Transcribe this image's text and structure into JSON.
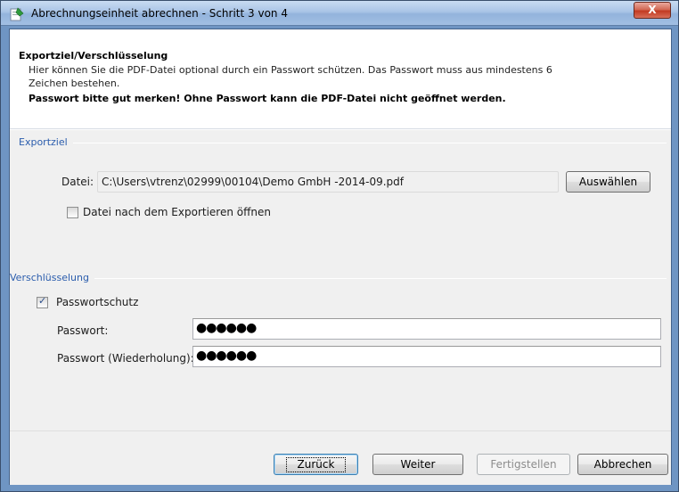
{
  "window": {
    "title": "Abrechnungseinheit abrechnen - Schritt 3 von 4",
    "close_label": "X"
  },
  "header": {
    "title": "Exportziel/Verschlüsselung",
    "description": "Hier können Sie die PDF-Datei optional durch ein Passwort schützen. Das Passwort muss aus mindestens 6 Zeichen bestehen.",
    "warning": "Passwort bitte gut merken! Ohne Passwort kann die PDF-Datei nicht geöffnet werden."
  },
  "exportziel": {
    "group_label": "Exportziel",
    "file_label": "Datei:",
    "file_path": "C:\\Users\\vtrenz\\02999\\00104\\Demo GmbH -2014-09.pdf",
    "choose_button": "Auswählen",
    "open_after_export_label": "Datei nach dem Exportieren öffnen",
    "open_after_export_checked": false
  },
  "verschluesselung": {
    "group_label": "Verschlüsselung",
    "password_protection_label": "Passwortschutz",
    "password_protection_checked": true,
    "password_label": "Passwort:",
    "password_value": "●●●●●●",
    "password_repeat_label": "Passwort (Wiederholung):",
    "password_repeat_value": "●●●●●●"
  },
  "footer": {
    "back_button": "Zurück",
    "next_button": "Weiter",
    "finish_button": "Fertigstellen",
    "cancel_button": "Abbrechen"
  }
}
